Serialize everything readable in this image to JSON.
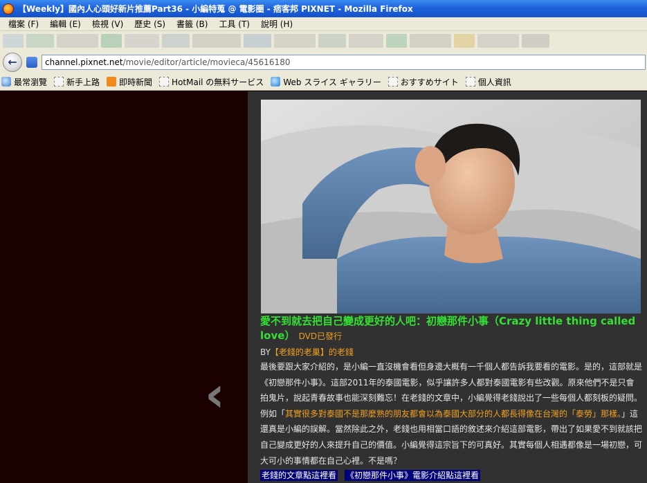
{
  "window": {
    "title": "【Weekly】國內人心頭好新片推薦Part36 - 小編特蒐 @ 電影圈 - 痞客邦 PIXNET - Mozilla Firefox"
  },
  "menu": [
    "檔案 (F)",
    "編輯 (E)",
    "檢視 (V)",
    "歷史 (S)",
    "書籤 (B)",
    "工具 (T)",
    "說明 (H)"
  ],
  "nav": {
    "url_domain": "channel.pixnet.net",
    "url_path": "/movie/editor/article/movieca/45616180"
  },
  "bookmarks": [
    "最常瀏覽",
    "新手上路",
    "即時新聞",
    "HotMail の無料サービス",
    "Web スライス ギャラリー",
    "おすすめサイト",
    "個人資訊"
  ],
  "article": {
    "headline": "愛不到就去把自己變成更好的人吧：初戀那件小事（Crazy little thing called love）",
    "headline_tag": "DVD已發行",
    "by_prefix": "BY",
    "by_author": "【老錢的老巢】的老錢",
    "body_1": "最後要跟大家介紹的，是小編一直沒機會看但身邊大概有一千個人都告訴我要看的電影。是的，這部就是《初戀那件小事》。這部2011年的泰國電影，似乎讓許多人都對泰國電影有些改觀。原來他們不是只會拍鬼片，說起青春故事也能深刻難忘！在老錢的文章中，小編覺得老錢說出了一些每個人都刻板的疑問。例如「",
    "body_highlight": "其實很多對泰國不是那麼熟的朋友都會以為泰國大部分的人都長得像在台灣的「泰勞」那樣。",
    "body_2": "」這還真是小編的誤解。當然除此之外，老錢也用相當口語的敘述來介紹這部電影，帶出了如果愛不到就該把自己變成更好的人來提升自己的價值。小編覺得這宗旨下的可真好。其實每個人相遇都像是一場初戀，可大可小的事情都在自己心裡。不是嗎？",
    "link_1": "老錢的文章點這裡看",
    "link_2": "《初戀那件小事》電影介紹點這裡看"
  },
  "colors": {
    "headline": "#33e033",
    "accent": "#f0a020",
    "page_bg": "#313131",
    "left_bg": "#1a0000",
    "link_bg": "#00007a"
  }
}
